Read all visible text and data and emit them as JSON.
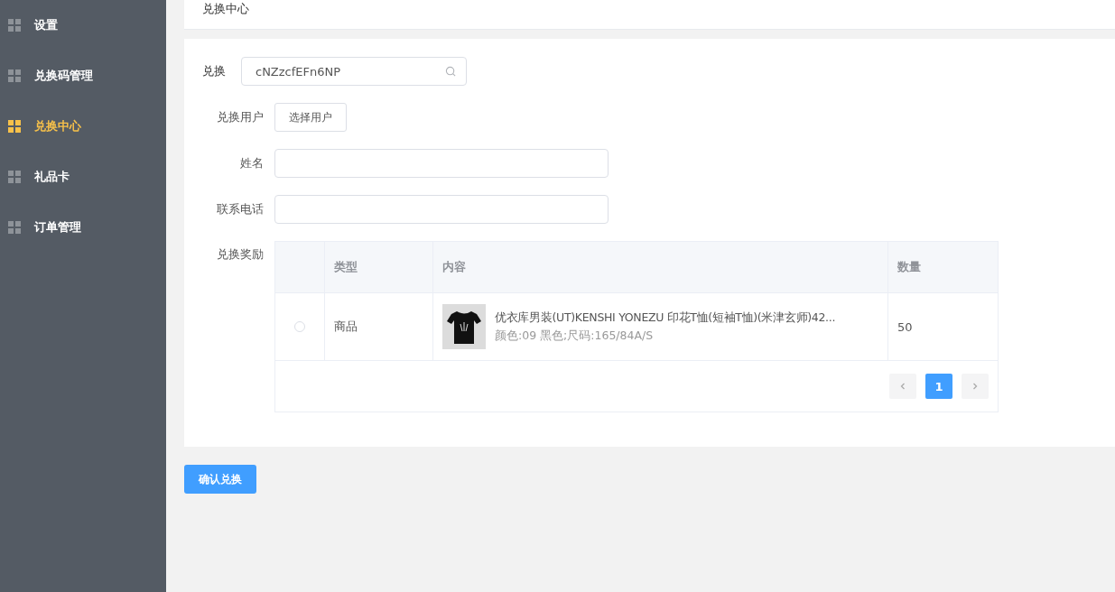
{
  "sidebar": {
    "items": [
      {
        "label": "设置",
        "selected": false
      },
      {
        "label": "兑换码管理",
        "selected": false
      },
      {
        "label": "兑换中心",
        "selected": true
      },
      {
        "label": "礼品卡",
        "selected": false
      },
      {
        "label": "订单管理",
        "selected": false
      }
    ]
  },
  "page_title": "兑换中心",
  "form": {
    "code_label": "兑换",
    "code_value": "cNZzcfEFn6NP",
    "user_label": "兑换用户",
    "user_button": "选择用户",
    "name_label": "姓名",
    "phone_label": "联系电话",
    "reward_label": "兑换奖励"
  },
  "table": {
    "columns": [
      "类型",
      "内容",
      "数量"
    ],
    "rows": [
      {
        "selected": false,
        "type": "商品",
        "title": "优衣库男装(UT)KENSHI YONEZU 印花T恤(短袖T恤)(米津玄师)42...",
        "spec": "颜色:09 黑色;尺码:165/84A/S",
        "quantity": "50"
      }
    ]
  },
  "pagination": {
    "pages": [
      {
        "label": "1",
        "selected": true
      }
    ]
  },
  "confirm_button": "确认兑换"
}
